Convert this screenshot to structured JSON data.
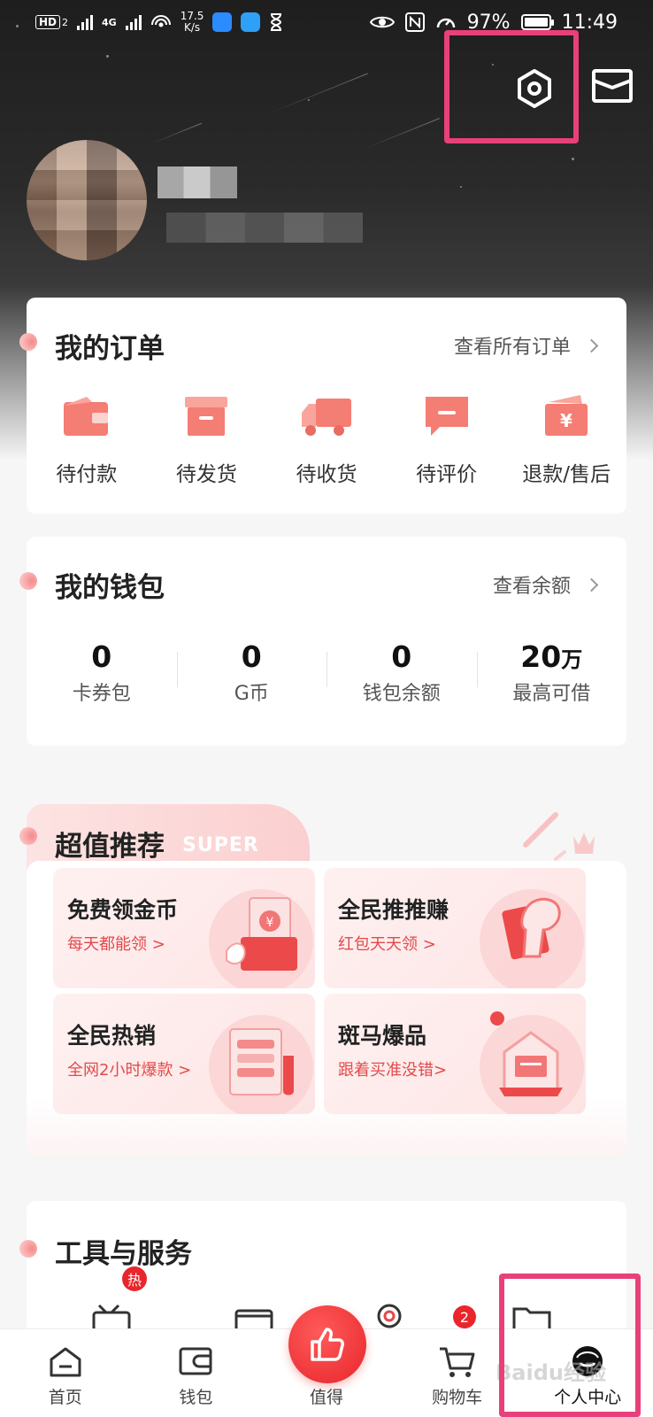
{
  "status_bar": {
    "network_badge": "HD",
    "sim_badge": "2",
    "signal_label": "4G",
    "speed_value": "17.5",
    "speed_unit": "K/s",
    "battery_percent": "97%",
    "time": "11:49"
  },
  "header": {
    "settings_icon": "settings-hexagon-icon",
    "message_icon": "message-envelope-icon"
  },
  "orders": {
    "title": "我的订单",
    "view_all": "查看所有订单",
    "items": [
      {
        "label": "待付款",
        "icon": "wallet-icon"
      },
      {
        "label": "待发货",
        "icon": "package-box-icon"
      },
      {
        "label": "待收货",
        "icon": "delivery-truck-icon"
      },
      {
        "label": "待评价",
        "icon": "comment-icon"
      },
      {
        "label": "退款/售后",
        "icon": "refund-icon"
      }
    ]
  },
  "wallet": {
    "title": "我的钱包",
    "view_balance": "查看余额",
    "items": [
      {
        "value": "0",
        "unit": "",
        "label": "卡券包"
      },
      {
        "value": "0",
        "unit": "",
        "label": "G币"
      },
      {
        "value": "0",
        "unit": "",
        "label": "钱包余额"
      },
      {
        "value": "20",
        "unit": "万",
        "label": "最高可借"
      }
    ]
  },
  "recommend": {
    "title": "超值推荐",
    "title_en": "SUPER",
    "tiles": [
      {
        "title": "免费领金币",
        "subtitle": "每天都能领 >"
      },
      {
        "title": "全民推推赚",
        "subtitle": "红包天天领 >"
      },
      {
        "title": "全民热销",
        "subtitle": "全网2小时爆款 >"
      },
      {
        "title": "斑马爆品",
        "subtitle": "跟着买准没错>"
      }
    ]
  },
  "tools": {
    "title": "工具与服务",
    "hot_badge": "热"
  },
  "tabbar": {
    "items": [
      {
        "label": "首页",
        "icon": "home-icon"
      },
      {
        "label": "钱包",
        "icon": "wallet-icon"
      },
      {
        "label": "值得",
        "icon": "thumbs-up-icon"
      },
      {
        "label": "购物车",
        "icon": "cart-icon"
      },
      {
        "label": "个人中心",
        "icon": "profile-icon"
      }
    ],
    "cart_badge": "2"
  },
  "watermark": "Baidu经验",
  "colors": {
    "accent": "#e8262c",
    "highlight": "#e8407a",
    "icon_coral": "#f47d74",
    "link_gray": "#555555"
  }
}
